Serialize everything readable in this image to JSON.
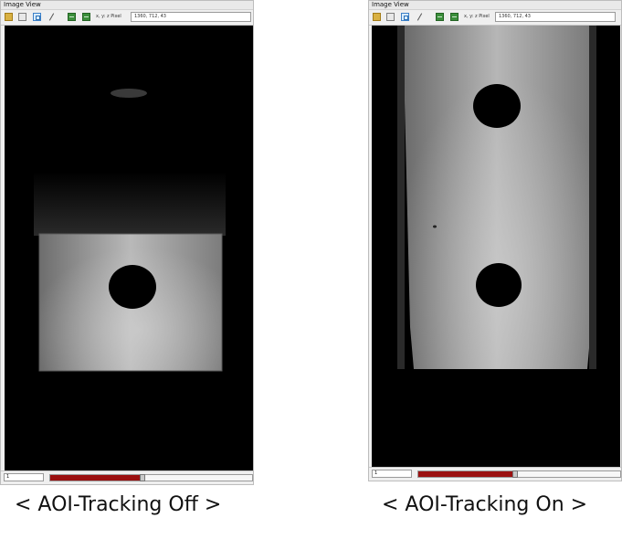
{
  "left_panel": {
    "title": "Image View",
    "toolbar": {
      "icons": [
        "open-folder-icon",
        "copy-icon",
        "rectangle-aoi-icon",
        "line-icon",
        "fit-width-icon",
        "fit-height-icon"
      ],
      "coord_label": "x, y: z Pixel",
      "coord_value": "1360, 712, 43"
    },
    "status": {
      "frame": "1",
      "progress": 0.45,
      "bar_color": "#9b1010"
    }
  },
  "right_panel": {
    "title": "Image View",
    "toolbar": {
      "icons": [
        "open-folder-icon",
        "copy-icon",
        "rectangle-aoi-icon",
        "line-icon",
        "fit-width-icon",
        "fit-height-icon"
      ],
      "coord_label": "x, y: z Pixel",
      "coord_value": "1360, 712, 43"
    },
    "status": {
      "frame": "1",
      "progress": 0.47,
      "bar_color": "#9b1010"
    }
  },
  "captions": {
    "left": "< AOI-Tracking Off >",
    "right": "< AOI-Tracking On >"
  }
}
